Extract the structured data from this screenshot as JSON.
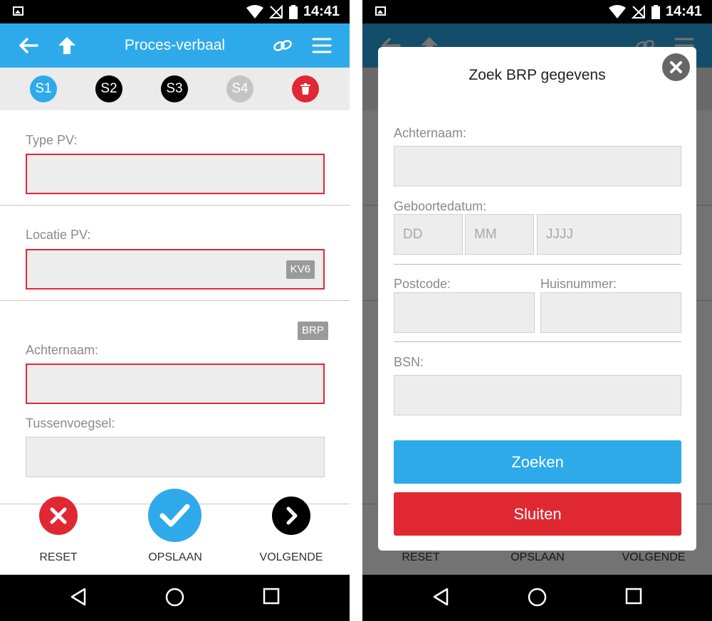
{
  "status": {
    "time": "14:41"
  },
  "navbar": {
    "title": "Proces-verbaal"
  },
  "steps": [
    {
      "label": "S1",
      "color": "#2eaaeb"
    },
    {
      "label": "S2",
      "color": "#000000"
    },
    {
      "label": "S3",
      "color": "#000000"
    },
    {
      "label": "S4",
      "color": "#c4c4c4"
    }
  ],
  "delete_color": "#e02832",
  "form": {
    "type_pv_label": "Type PV:",
    "locatie_label": "Locatie PV:",
    "kv6_tag": "KV6",
    "brp_tag": "BRP",
    "achternaam_label": "Achternaam:",
    "tussenvoegsel_label": "Tussenvoegsel:"
  },
  "bottom": {
    "reset_label": "RESET",
    "opslaan_label": "OPSLAAN",
    "volgende_label": "VOLGENDE"
  },
  "modal": {
    "title": "Zoek BRP gegevens",
    "achternaam_label": "Achternaam:",
    "geboortedatum_label": "Geboortedatum:",
    "dd_placeholder": "DD",
    "mm_placeholder": "MM",
    "jjjj_placeholder": "JJJJ",
    "postcode_label": "Postcode:",
    "huisnummer_label": "Huisnummer:",
    "bsn_label": "BSN:",
    "zoeken_label": "Zoeken",
    "sluiten_label": "Sluiten"
  },
  "colors": {
    "accent": "#2eaaeb",
    "danger": "#e02832",
    "tag": "#9a9a9a"
  }
}
